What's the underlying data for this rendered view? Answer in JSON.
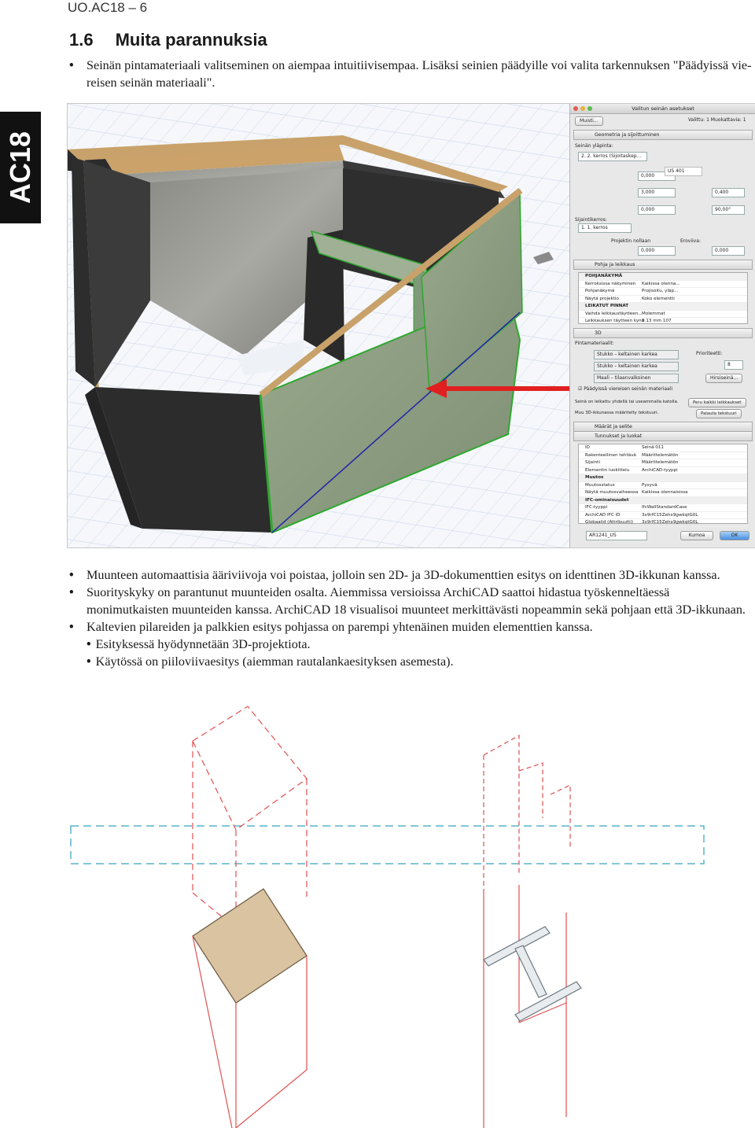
{
  "header": {
    "text": "UO.AC18 – 6"
  },
  "side_tab": {
    "label": "AC18"
  },
  "section": {
    "number": "1.6",
    "title": "Muita parannuksia"
  },
  "intro_bullets": [
    "Seinän pintamateriaali valitseminen on aiempaa intuitiivisempaa. Lisäksi seinien päädyille voi valita tarkennuksen \"Päädyissä vie­reisen seinän materiaali\"."
  ],
  "dialog": {
    "title": "Valitun seinän asetukset",
    "favorites_button": "Muisti...",
    "selection_info": "Valittu: 1 Muokattavia: 1",
    "geometry_section": "Geometria ja sijoittuminen",
    "top_link_label": "Seinän yläpinta:",
    "top_link_value": "2. 2. kerros (Sijoitaskер...",
    "home_story_label": "Sijaintikerros:",
    "home_story_value": "1. 1. kerros",
    "offset_label": "Projektin nollaan",
    "offset_right_label": "Ero­viiva:",
    "fields": [
      "0,000",
      "3,000",
      "0,000",
      "0,000",
      "0,000"
    ],
    "right_fields": [
      "US 401",
      "0,400",
      "90,00°"
    ],
    "floorplan_section": "Pohja ja leikkaus",
    "floorplan_rows": [
      [
        "POHJANÄKYMÄ",
        ""
      ],
      [
        "Kerroksissa näkyminen",
        "Kaikissa olenna..."
      ],
      [
        "Pohjanäkymä",
        "Projisoitu, yläp..."
      ],
      [
        "Näytä projektio",
        "Koko elementti"
      ],
      [
        "LEIKATUT PINNAT",
        ""
      ],
      [
        "Vaihda leikkaustäytteen...",
        "Molemmat"
      ],
      [
        "Leikkauksen täytteen kynä",
        "0.13 mm        107"
      ]
    ],
    "section_3d": "3D",
    "surface_label": "Pintamateriaalit:",
    "surfaces": [
      "Stukko – keltainen karkea",
      "Stukko – keltainen karkea",
      "Maali – tilaanvalkoinen"
    ],
    "priority_label": "Prioriteetti:",
    "priority_value": "8",
    "log_button": "Hirsiseinä...",
    "end_checkbox": "Päädyissä viereisen seinän materiaali",
    "note_1": "Seinä on leikattu yhdellä tai useammalla katolla.",
    "note_1_button": "Peru kaikki leikkaukset",
    "note_2": "Muu 3D-ikkunassa määritelty tekstuuri.",
    "note_2_button": "Palauta tekstuuri",
    "legend_section": "Määrät ja selite",
    "tags_section": "Tunnukset ja luokat",
    "tags_rows": [
      [
        "ID",
        "Seinä 011"
      ],
      [
        "Rakenteellinen tehtävä",
        "Määrittelemätön"
      ],
      [
        "Sijainti",
        "Määrittelemätön"
      ],
      [
        "Elementin luokittelu",
        "ArchiCAD-tyyppi"
      ],
      [
        "Muutos",
        ""
      ],
      [
        "Muutosstatus",
        "Pysyvä"
      ],
      [
        "Näytä muutosvaiheessa",
        "Kaikissa olennaisissa"
      ],
      [
        "IFC-ominaisuudet",
        ""
      ],
      [
        "IFC-tyyppi",
        "IfcWallStandardCase"
      ],
      [
        "ArchiCAD IFC ID",
        "3x9rfC15Zehx9gwkqtG0L"
      ],
      [
        "Globaalid (Attribuutti)",
        "3x9rfC15Zehx9gwkqtG0L"
      ]
    ],
    "layer_value": "AR1241_US",
    "cancel_button": "Kumoa",
    "ok_button": "OK"
  },
  "bullets": [
    {
      "type": "main",
      "text": "Muunteen automaattisia ääriviivoja voi poistaa, jolloin sen 2D- ja 3D-dokumenttien esitys on identtinen 3D-ikkunan kanssa."
    },
    {
      "type": "main",
      "text": "Suorityskyky on parantunut muunteiden osalta. Aiemmissa versioissa ArchiCAD saattoi hidastua työskenneltäessä monimutkaisten muunteiden kanssa. ArchiCAD 18 visualisoi muunteet merkittävästi nopeammin sekä pohjaan että 3D-ikkunaan."
    },
    {
      "type": "main",
      "text": "Kaltevien pilareiden ja palkkien esitys pohjassa on parempi yhtenäinen muiden elementtien kanssa."
    },
    {
      "type": "sub",
      "text": "Esityksessä hyödynnetään 3D-projektiota."
    },
    {
      "type": "sub",
      "text": "Käytössä on piiloviivaesitys (aiemman rautalankaesityksen asemesta)."
    }
  ],
  "colors": {
    "red": "#e02020",
    "dashed_red": "#e05050",
    "dashed_cyan": "#5ab4c8",
    "column_fill": "#d9c3a0",
    "wall_green": "#2ea82e"
  }
}
